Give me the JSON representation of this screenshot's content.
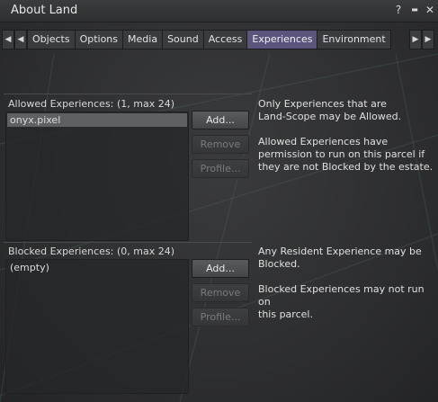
{
  "window": {
    "title": "About Land",
    "help_glyph": "?",
    "minimize_glyph": "▬",
    "close_glyph": "✕"
  },
  "tabs": {
    "first_glyph": "◀",
    "prev_glyph": "◀",
    "next_glyph": "▶",
    "last_glyph": "▶",
    "items": [
      {
        "label": "Objects"
      },
      {
        "label": "Options"
      },
      {
        "label": "Media"
      },
      {
        "label": "Sound"
      },
      {
        "label": "Access"
      },
      {
        "label": "Experiences",
        "active": true
      },
      {
        "label": "Environment"
      }
    ]
  },
  "allowed": {
    "header": "Allowed Experiences:",
    "count": "(1, max 24)",
    "items": [
      "onyx.pixel"
    ],
    "add_label": "Add...",
    "remove_label": "Remove",
    "profile_label": "Profile...",
    "help": "Only Experiences that are\nLand-Scope may be Allowed.\n\nAllowed Experiences have\npermission to run on this parcel if\nthey are not Blocked by the estate."
  },
  "blocked": {
    "header": "Blocked Experiences:",
    "count": "(0, max 24)",
    "items": [
      "(empty)"
    ],
    "add_label": "Add...",
    "remove_label": "Remove",
    "profile_label": "Profile...",
    "help": "Any Resident Experience may be\nBlocked.\n\nBlocked Experiences may not run on\nthis parcel."
  }
}
